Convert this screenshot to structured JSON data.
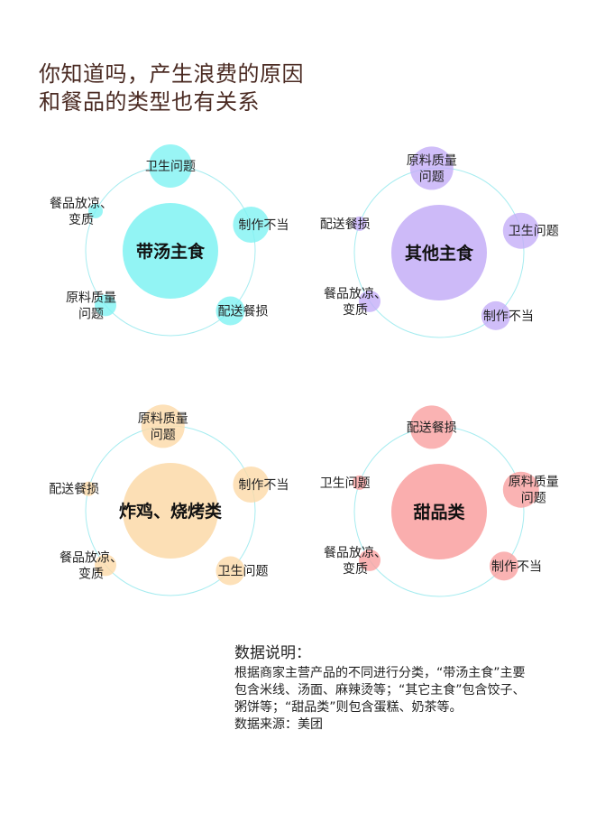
{
  "headline": {
    "line1": "你知道吗，产生浪费的原因",
    "line2": "和餐品的类型也有关系"
  },
  "chart_data": [
    {
      "type": "bubble",
      "title": "带汤主食",
      "color": "#7ff2f2",
      "points": [
        {
          "label": "卫生问题",
          "value": 5
        },
        {
          "label": "制作不当",
          "value": 4
        },
        {
          "label": "配送餐损",
          "value": 3
        },
        {
          "label": "原料质量问题",
          "value": 2
        },
        {
          "label": "餐品放凉、变质",
          "value": 1
        }
      ]
    },
    {
      "type": "bubble",
      "title": "其他主食",
      "color": "#c4aef7",
      "points": [
        {
          "label": "原料质量问题",
          "value": 5
        },
        {
          "label": "卫生问题",
          "value": 4
        },
        {
          "label": "制作不当",
          "value": 3
        },
        {
          "label": "餐品放凉、变质",
          "value": 2
        },
        {
          "label": "配送餐损",
          "value": 1
        }
      ]
    },
    {
      "type": "bubble",
      "title": "炸鸡、烧烤类",
      "color": "#fcd9a8",
      "points": [
        {
          "label": "原料质量问题",
          "value": 5
        },
        {
          "label": "制作不当",
          "value": 4
        },
        {
          "label": "卫生问题",
          "value": 3
        },
        {
          "label": "餐品放凉、变质",
          "value": 2
        },
        {
          "label": "配送餐损",
          "value": 1
        }
      ]
    },
    {
      "type": "bubble",
      "title": "甜品类",
      "color": "#f9a0a0",
      "points": [
        {
          "label": "配送餐损",
          "value": 5
        },
        {
          "label": "原料质量问题",
          "value": 4
        },
        {
          "label": "制作不当",
          "value": 3
        },
        {
          "label": "餐品放凉、变质",
          "value": 2
        },
        {
          "label": "卫生问题",
          "value": 1
        }
      ]
    }
  ],
  "notes": {
    "title": "数据说明：",
    "body": "根据商家主营产品的不同进行分类，“带汤主食”主要包含米线、汤面、麻辣烫等；“其它主食”包含饺子、粥饼等；“甜品类”则包含蛋糕、奶茶等。",
    "source": "数据来源：美团"
  }
}
